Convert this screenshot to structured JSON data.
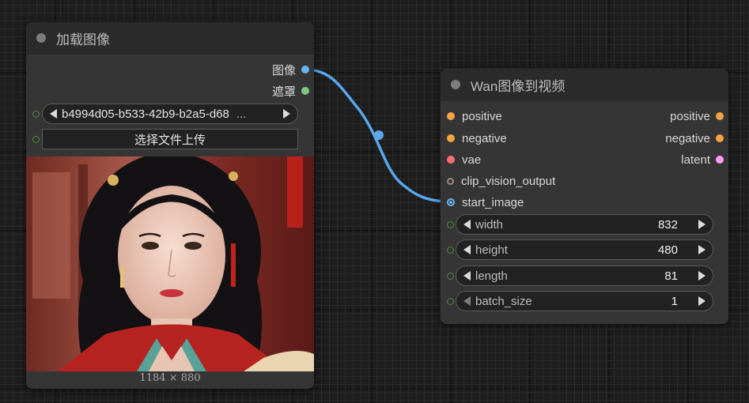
{
  "load_image_node": {
    "title": "加载图像",
    "outputs": [
      {
        "label": "图像",
        "color": "#64b5f6"
      },
      {
        "label": "遮罩",
        "color": "#81c784"
      }
    ],
    "image_combo": {
      "value": "b4994d05-b533-42b9-b2a5-d68",
      "ellipsis": "..."
    },
    "upload_button": "选择文件上传",
    "image_size": "1184 × 880"
  },
  "wan_node": {
    "title": "Wan图像到视频",
    "inputs": [
      {
        "label": "positive",
        "color": "#f5a442"
      },
      {
        "label": "negative",
        "color": "#f5a442"
      },
      {
        "label": "vae",
        "color": "#ff6e6e"
      },
      {
        "label": "clip_vision_output",
        "color": "#a1887f"
      },
      {
        "label": "start_image",
        "color": "#64b5f6"
      }
    ],
    "outputs": [
      {
        "label": "positive",
        "color": "#f5a442"
      },
      {
        "label": "negative",
        "color": "#f5a442"
      },
      {
        "label": "latent",
        "color": "#ff9cf9"
      }
    ],
    "widgets": [
      {
        "label": "width",
        "value": "832"
      },
      {
        "label": "height",
        "value": "480"
      },
      {
        "label": "length",
        "value": "81"
      },
      {
        "label": "batch_size",
        "value": "1"
      }
    ]
  }
}
